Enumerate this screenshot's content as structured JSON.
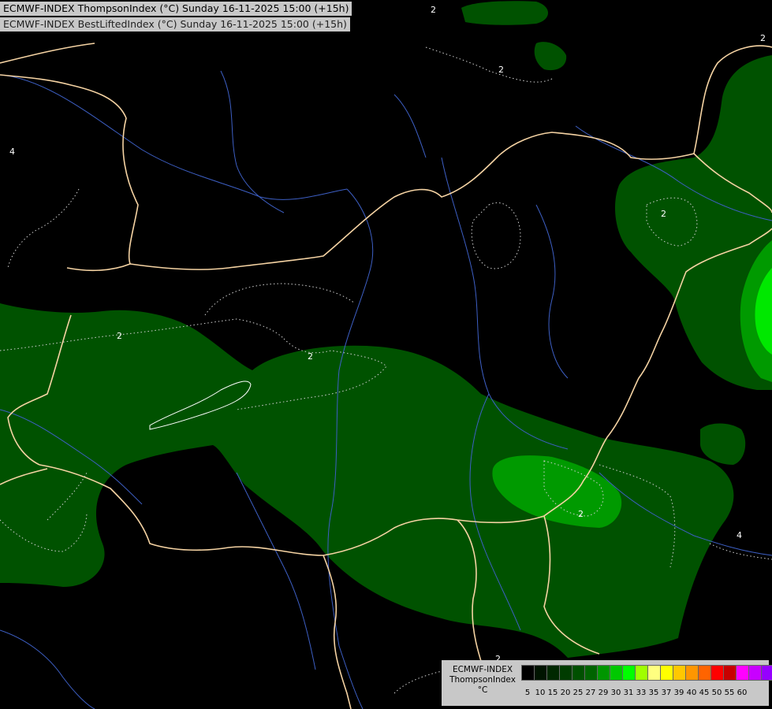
{
  "titles": {
    "line1": "ECMWF-INDEX ThompsonIndex (°C) Sunday 16-11-2025 15:00 (+15h)",
    "line2": "ECMWF-INDEX BestLiftedIndex (°C) Sunday 16-11-2025 15:00 (+15h)"
  },
  "legend": {
    "line1": "ECMWF-INDEX",
    "line2": "ThompsonIndex",
    "unit": "°C",
    "swatch_colors": [
      "#000000",
      "#001400",
      "#002800",
      "#003c00",
      "#005000",
      "#006400",
      "#009600",
      "#00c800",
      "#00ff00",
      "#a0ff00",
      "#ffff80",
      "#ffff00",
      "#ffc800",
      "#ff9600",
      "#ff6400",
      "#ff0000",
      "#c80000",
      "#ff00ff",
      "#c800ff",
      "#9600ff",
      "#6400ff",
      "#0000ff"
    ],
    "ticks": [
      "5",
      "10",
      "15",
      "20",
      "25",
      "27",
      "29",
      "30",
      "31",
      "33",
      "35",
      "37",
      "39",
      "40",
      "45",
      "50",
      "55",
      "60"
    ]
  },
  "contour_labels": [
    "2",
    "2",
    "2",
    "2",
    "2",
    "2",
    "2",
    "2",
    "4",
    "4"
  ],
  "colors": {
    "background": "#000000",
    "dark_green": "#005200",
    "mid_green": "#009a00",
    "bright_green": "#00e800",
    "border": "#f5d3a3",
    "river": "#3d5fc4"
  }
}
